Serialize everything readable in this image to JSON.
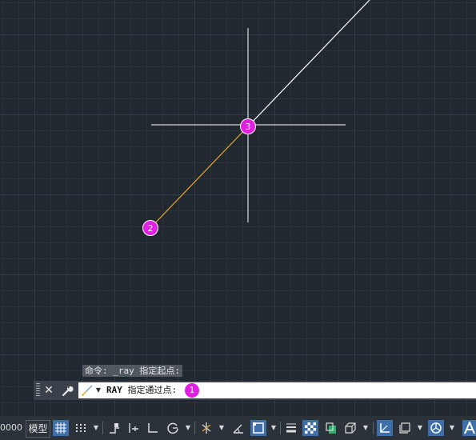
{
  "command_line": {
    "history": "命令: _ray 指定起点:",
    "prompt_command": "RAY",
    "prompt_text": "指定通过点:",
    "prompt_marker": "1",
    "close_symbol": "✕"
  },
  "canvas": {
    "markers": [
      "2",
      "3"
    ],
    "colors": {
      "background": "#212830",
      "ray_line": "#ffffff",
      "rubberband_line": "#e6a92e",
      "crosshair": "#ffffff",
      "marker": "#e21ee2"
    }
  },
  "status_bar": {
    "coordinate_readout": "0000",
    "model_tab": "模型",
    "accent": "#3e6fa8"
  },
  "icons": {
    "cmd_grip": "grip-icon",
    "cmd_close": "close-icon",
    "cmd_customize": "wrench-icon",
    "cmd_ray": "ray-command-icon",
    "grid": "grid-icon",
    "snap": "snap-icon",
    "infer": "infer-constraints-icon",
    "dynamic_input": "dynamic-input-icon",
    "ortho": "ortho-icon",
    "polar": "polar-tracking-icon",
    "isodraft": "isodraft-icon",
    "object_snap_tracking": "object-snap-tracking-icon",
    "object_snap": "object-snap-icon",
    "lineweight": "lineweight-icon",
    "transparency": "transparency-icon",
    "selection_cycling": "selection-cycling-icon",
    "3d_osnap": "3d-object-snap-icon",
    "ucs": "dynamic-ucs-icon",
    "selection_filter": "selection-filter-icon",
    "gizmo": "gizmo-icon",
    "annotation": "annotation-scale-icon"
  }
}
